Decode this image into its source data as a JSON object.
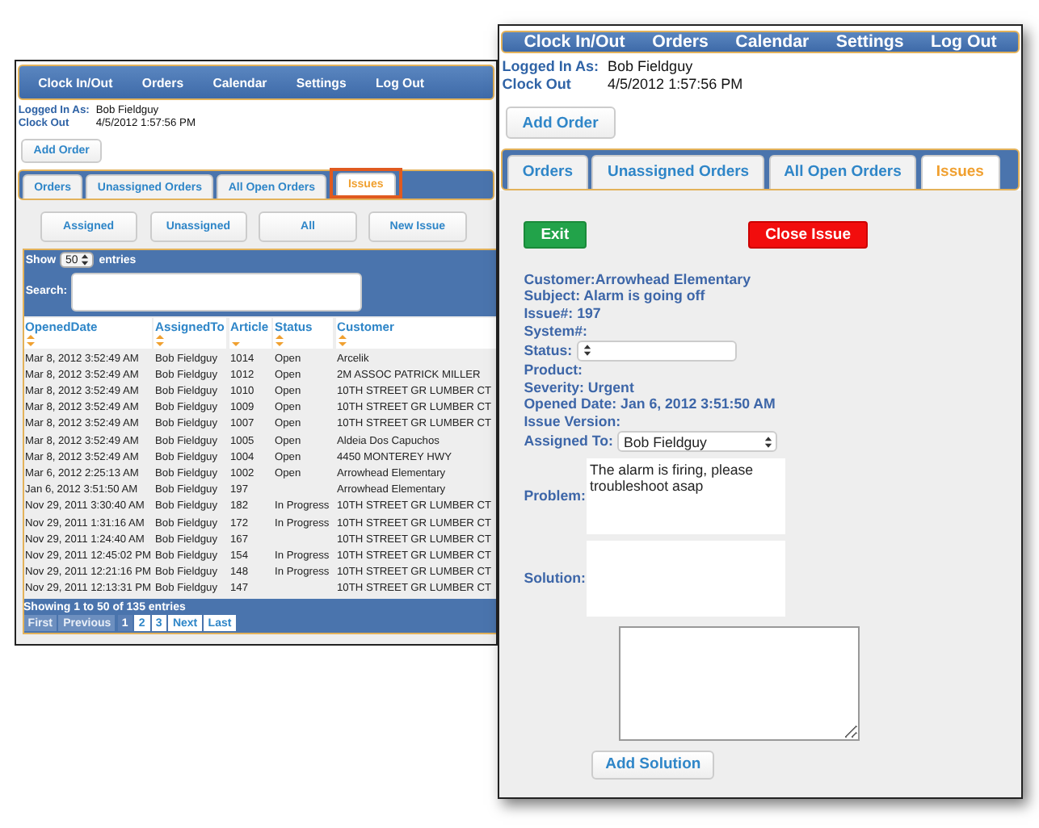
{
  "list_window": {
    "nav": [
      "Clock In/Out",
      "Orders",
      "Calendar",
      "Settings",
      "Log Out"
    ],
    "info": [
      {
        "label": "Logged In As:",
        "value": "Bob Fieldguy"
      },
      {
        "label": "Clock Out",
        "value": "4/5/2012 1:57:56 PM"
      }
    ],
    "add_order": "Add Order",
    "tabs": [
      {
        "label": "Orders",
        "selected": false,
        "callout": false
      },
      {
        "label": "Unassigned Orders",
        "selected": false,
        "callout": false
      },
      {
        "label": "All Open Orders",
        "selected": false,
        "callout": false
      },
      {
        "label": "Issues",
        "selected": true,
        "callout": true
      }
    ],
    "filter_buttons": [
      "Assigned",
      "Unassigned",
      "All",
      "New Issue"
    ],
    "show_label": "Show",
    "page_size": "50",
    "entries_label": "entries",
    "search_label": "Search:",
    "table": {
      "columns": [
        {
          "label": "OpenedDate",
          "sorted": false
        },
        {
          "label": "AssignedTo",
          "sorted": false
        },
        {
          "label": "Article",
          "sorted": true
        },
        {
          "label": "Status",
          "sorted": false
        },
        {
          "label": "Customer",
          "sorted": false
        }
      ],
      "rows": [
        [
          "Mar 8, 2012 3:52:49 AM",
          "Bob Fieldguy",
          "1014",
          "Open",
          "Arcelik"
        ],
        [
          "Mar 8, 2012 3:52:49 AM",
          "Bob Fieldguy",
          "1012",
          "Open",
          "2M ASSOC PATRICK MILLER"
        ],
        [
          "Mar 8, 2012 3:52:49 AM",
          "Bob Fieldguy",
          "1010",
          "Open",
          "10TH STREET GR LUMBER CT"
        ],
        [
          "Mar 8, 2012 3:52:49 AM",
          "Bob Fieldguy",
          "1009",
          "Open",
          "10TH STREET GR LUMBER CT"
        ],
        [
          "Mar 8, 2012 3:52:49 AM",
          "Bob Fieldguy",
          "1007",
          "Open",
          "10TH STREET GR LUMBER CT"
        ],
        [
          "Mar 8, 2012 3:52:49 AM",
          "Bob Fieldguy",
          "1005",
          "Open",
          "Aldeia Dos Capuchos"
        ],
        [
          "Mar 8, 2012 3:52:49 AM",
          "Bob Fieldguy",
          "1004",
          "Open",
          "4450 MONTEREY HWY"
        ],
        [
          "Mar 6, 2012 2:25:13 AM",
          "Bob Fieldguy",
          "1002",
          "Open",
          "Arrowhead Elementary"
        ],
        [
          "Jan 6, 2012 3:51:50 AM",
          "Bob Fieldguy",
          "197",
          "",
          "Arrowhead Elementary"
        ],
        [
          "Nov 29, 2011 3:30:40 AM",
          "Bob Fieldguy",
          "182",
          "In Progress",
          "10TH STREET GR LUMBER CT"
        ],
        [
          "Nov 29, 2011 1:31:16 AM",
          "Bob Fieldguy",
          "172",
          "In Progress",
          "10TH STREET GR LUMBER CT"
        ],
        [
          "Nov 29, 2011 1:24:40 AM",
          "Bob Fieldguy",
          "167",
          "",
          "10TH STREET GR LUMBER CT"
        ],
        [
          "Nov 29, 2011 12:45:02 PM",
          "Bob Fieldguy",
          "154",
          "In Progress",
          "10TH STREET GR LUMBER CT"
        ],
        [
          "Nov 29, 2011 12:21:16 PM",
          "Bob Fieldguy",
          "148",
          "In Progress",
          "10TH STREET GR LUMBER CT"
        ],
        [
          "Nov 29, 2011 12:13:31 PM",
          "Bob Fieldguy",
          "147",
          "",
          "10TH STREET GR LUMBER CT"
        ]
      ]
    },
    "summary": "Showing 1 to 50 of 135 entries",
    "pager": [
      {
        "label": "First",
        "disabled": true,
        "selected": false
      },
      {
        "label": "Previous",
        "disabled": true,
        "selected": false
      },
      {
        "label": "1",
        "disabled": false,
        "selected": true
      },
      {
        "label": "2",
        "disabled": false,
        "selected": false
      },
      {
        "label": "3",
        "disabled": false,
        "selected": false
      },
      {
        "label": "Next",
        "disabled": false,
        "selected": false
      },
      {
        "label": "Last",
        "disabled": false,
        "selected": false
      }
    ]
  },
  "detail_window": {
    "nav": [
      "Clock In/Out",
      "Orders",
      "Calendar",
      "Settings",
      "Log Out"
    ],
    "info": [
      {
        "label": "Logged In As:",
        "value": "Bob Fieldguy"
      },
      {
        "label": "Clock Out",
        "value": "4/5/2012 1:57:56 PM"
      }
    ],
    "add_order": "Add Order",
    "tabs": [
      {
        "label": "Orders",
        "selected": false,
        "callout": false
      },
      {
        "label": "Unassigned Orders",
        "selected": false,
        "callout": false
      },
      {
        "label": "All Open Orders",
        "selected": false,
        "callout": false
      },
      {
        "label": "Issues",
        "selected": true,
        "callout": false
      }
    ],
    "exit": "Exit",
    "close_issue": "Close Issue",
    "fields": [
      {
        "kind": "text",
        "text": "Customer:Arrowhead Elementary"
      },
      {
        "kind": "text",
        "text": "Subject: Alarm is going off"
      },
      {
        "kind": "text",
        "text": "Issue#: 197"
      },
      {
        "kind": "text",
        "text": "System#:"
      },
      {
        "kind": "select",
        "label": "Status:"
      },
      {
        "kind": "text",
        "text": "Product:"
      },
      {
        "kind": "text",
        "text": "Severity: Urgent"
      },
      {
        "kind": "text",
        "text": "Opened Date: Jan 6, 2012 3:51:50 AM"
      },
      {
        "kind": "text",
        "text": "Issue Version:"
      },
      {
        "kind": "select",
        "label": "Assigned To:",
        "value": "Bob Fieldguy"
      }
    ],
    "problem": {
      "label": "Problem:",
      "value": "The alarm is firing, please troubleshoot asap"
    },
    "solution": {
      "label": "Solution:"
    },
    "add_solution": "Add Solution"
  }
}
